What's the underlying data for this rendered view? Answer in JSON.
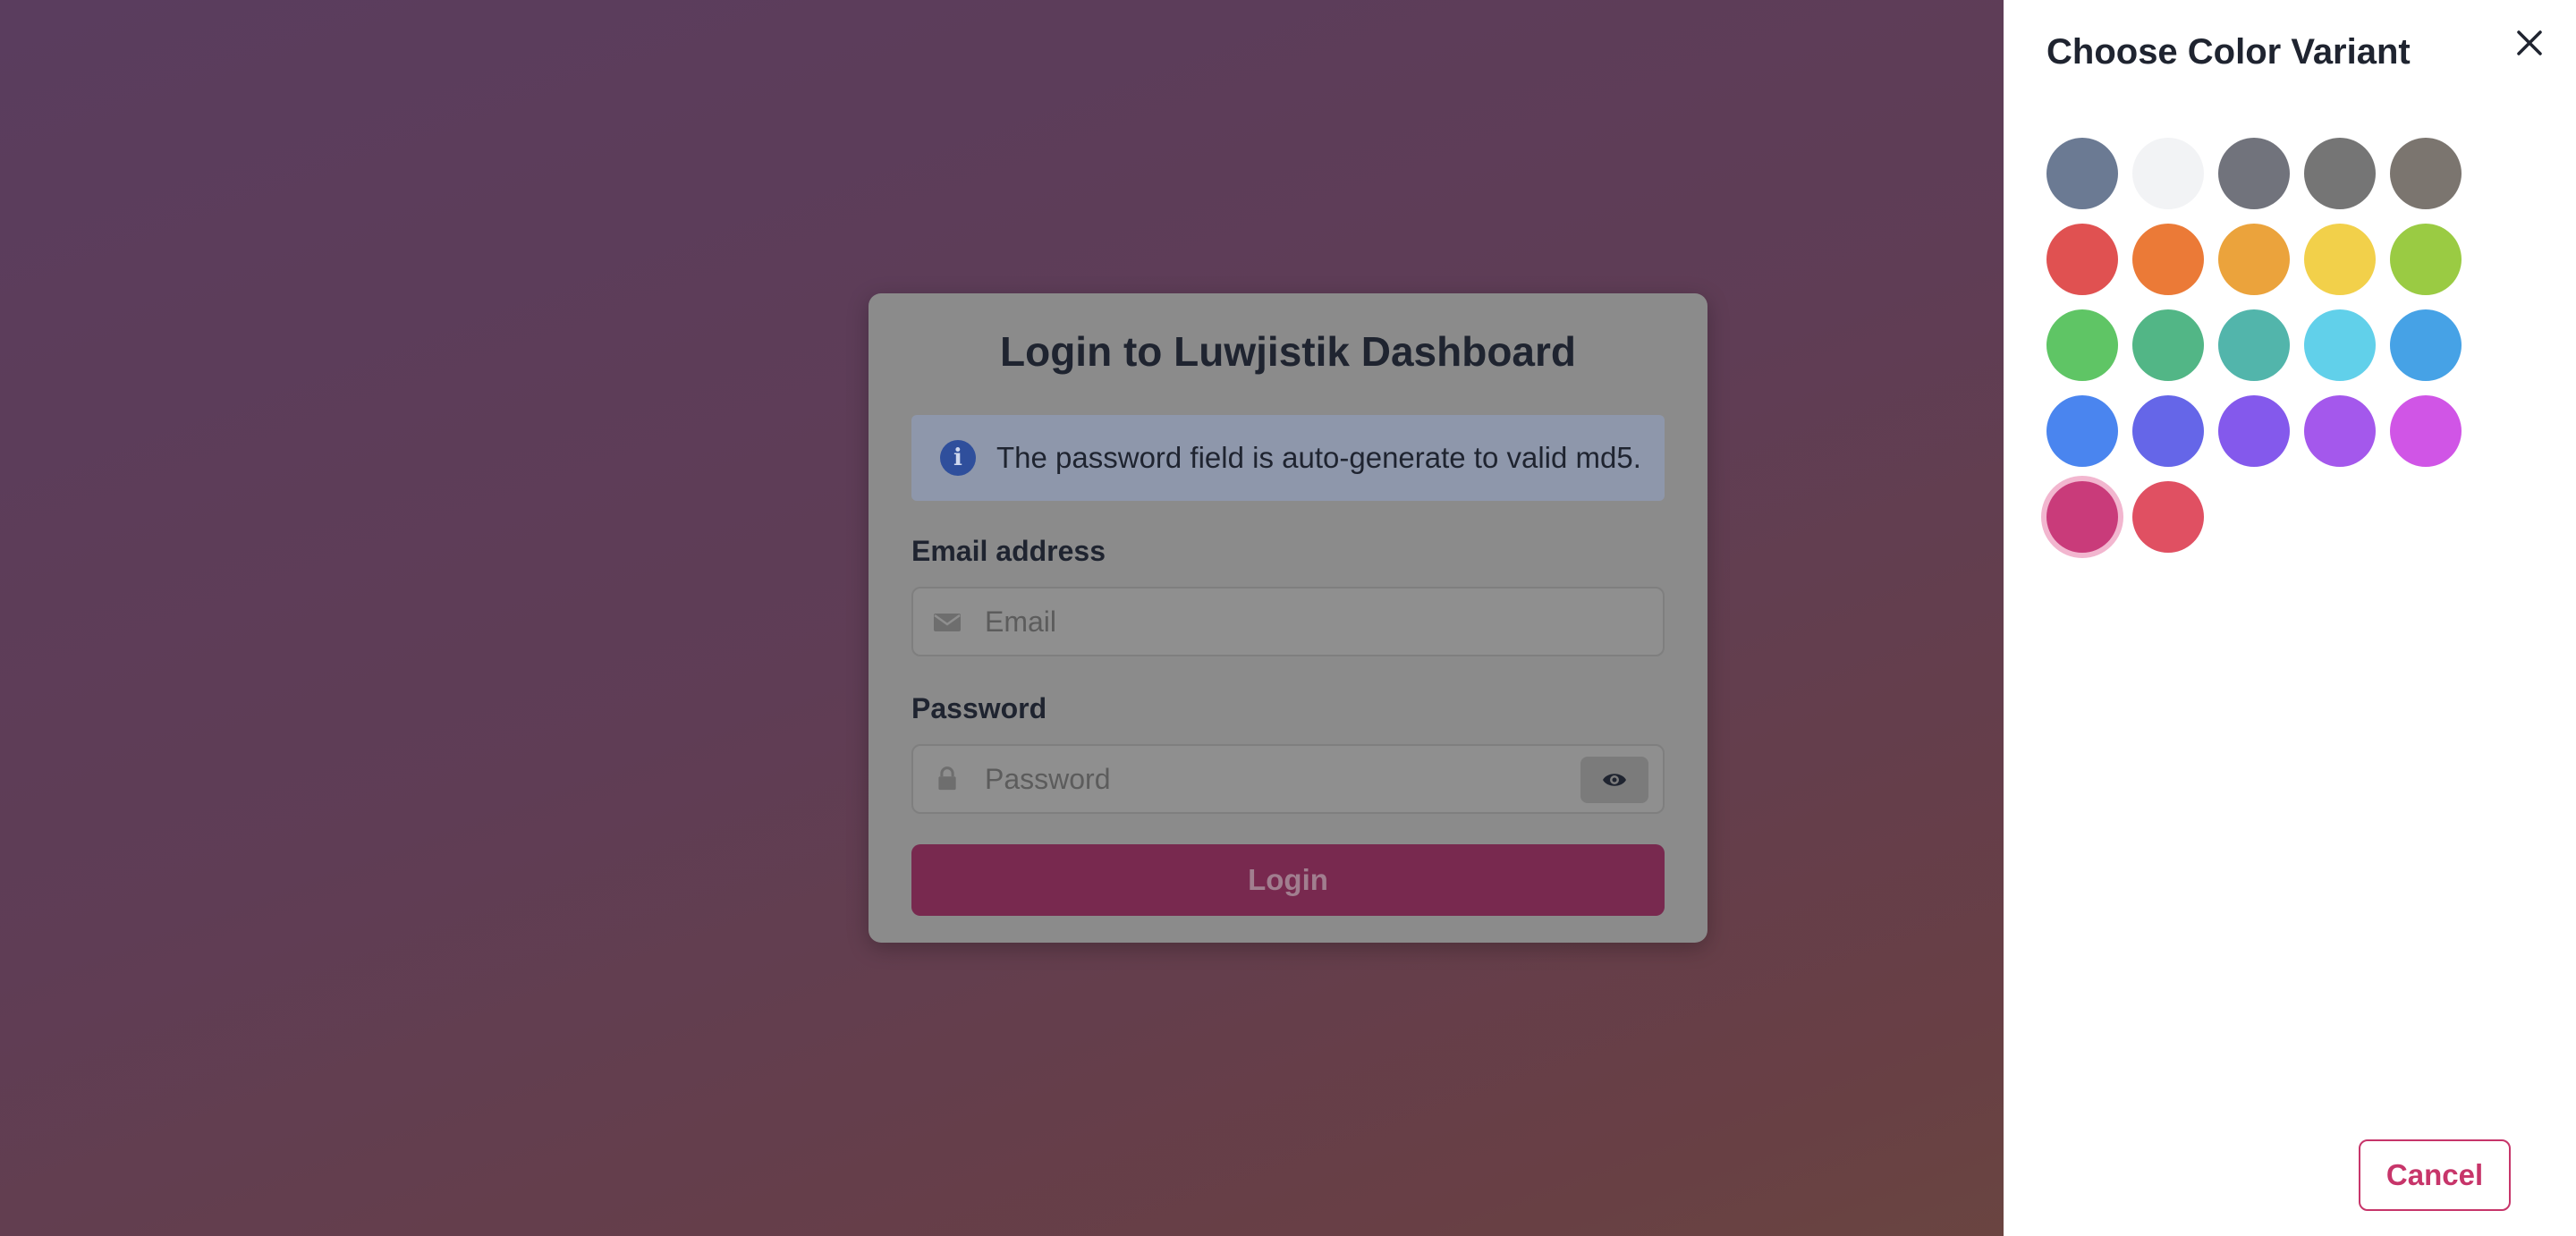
{
  "login": {
    "title": "Login to Luwjistik Dashboard",
    "info_icon": "info-icon",
    "alert_text": "The password field is auto-generate to valid md5.",
    "email_label": "Email address",
    "email_placeholder": "Email",
    "email_icon": "envelope-icon",
    "password_label": "Password",
    "password_placeholder": "Password",
    "password_icon": "lock-icon",
    "show_password_icon": "eye-icon",
    "login_button": "Login"
  },
  "panel": {
    "title": "Choose Color Variant",
    "close_icon": "close-icon",
    "cancel_button": "Cancel",
    "selected_index": 25,
    "colors": [
      "#6b7a93",
      "#f2f3f5",
      "#71737c",
      "#757575",
      "#7b756f",
      "#e05151",
      "#eb7a37",
      "#eba33c",
      "#f2d04a",
      "#9acb43",
      "#5fc565",
      "#52b686",
      "#52b5ab",
      "#61d0ea",
      "#46a2e6",
      "#4a85ef",
      "#6566e8",
      "#8459ec",
      "#a458ec",
      "#d055e6",
      "#c93b7a",
      "#e05062"
    ]
  },
  "accent": "#c7356a"
}
